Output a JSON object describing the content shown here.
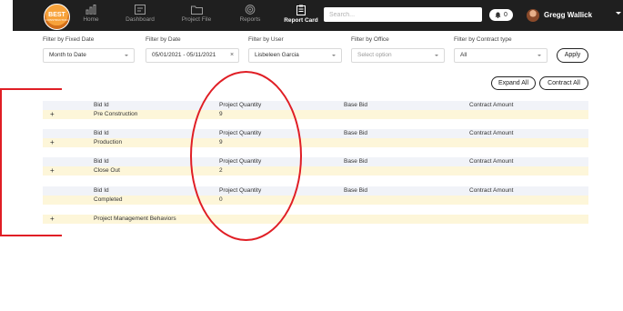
{
  "app": {
    "logo_text": "BEST",
    "logo_sub": "CONSTRUCTION"
  },
  "nav": {
    "items": [
      {
        "label": "Home",
        "icon": "bar-chart-icon"
      },
      {
        "label": "Dashboard",
        "icon": "dashboard-icon"
      },
      {
        "label": "Project File",
        "icon": "folder-icon"
      },
      {
        "label": "Reports",
        "icon": "target-icon"
      },
      {
        "label": "Report Card",
        "icon": "clipboard-icon",
        "active": true
      }
    ],
    "search_placeholder": "Search...",
    "notifications_count": "0",
    "user_name": "Gregg Wallick"
  },
  "filters": {
    "fixed_date": {
      "label": "Filter by Fixed Date",
      "value": "Month to Date"
    },
    "date": {
      "label": "Filter by Date",
      "value": "05/01/2021 - 05/11/2021",
      "clear": "×"
    },
    "user": {
      "label": "Filter by User",
      "value": "Lisbeleen Garcia"
    },
    "office": {
      "label": "Filter by Office",
      "placeholder": "Select option"
    },
    "contract_type": {
      "label": "Filter by Contract type",
      "value": "All"
    },
    "apply_label": "Apply"
  },
  "actions": {
    "expand_all": "Expand All",
    "contract_all": "Contract All"
  },
  "table": {
    "columns": [
      "Bid Id",
      "Project Quantity",
      "Base Bid",
      "Contract Amount"
    ],
    "groups": [
      {
        "expand": "+",
        "name": "Pre Construction",
        "quantity": "9"
      },
      {
        "expand": "+",
        "name": "Production",
        "quantity": "9"
      },
      {
        "expand": "+",
        "name": "Close Out",
        "quantity": "2"
      },
      {
        "expand": "",
        "name": "Completed",
        "quantity": "0"
      }
    ],
    "extra_row": {
      "expand": "+",
      "name": "Project Management Behaviors"
    }
  },
  "annotation_color": "#e01e25"
}
